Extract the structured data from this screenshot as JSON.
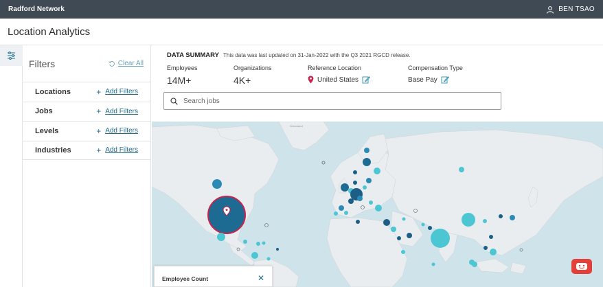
{
  "topbar": {
    "brand": "Radford Network",
    "user_name": "BEN TSAO"
  },
  "page": {
    "title": "Location Analytics"
  },
  "filters": {
    "title": "Filters",
    "clear_all": "Clear All",
    "items": [
      {
        "label": "Locations",
        "action": "Add Filters"
      },
      {
        "label": "Jobs",
        "action": "Add Filters"
      },
      {
        "label": "Levels",
        "action": "Add Filters"
      },
      {
        "label": "Industries",
        "action": "Add Filters"
      }
    ]
  },
  "summary": {
    "heading": "DATA SUMMARY",
    "note": "This data was last updated on 31-Jan-2022 with the Q3 2021 RGCD release.",
    "employees": {
      "label": "Employees",
      "value": "14M+"
    },
    "organizations": {
      "label": "Organizations",
      "value": "4K+"
    },
    "reference_location": {
      "label": "Reference Location",
      "value": "United States"
    },
    "compensation_type": {
      "label": "Compensation Type",
      "value": "Base Pay"
    }
  },
  "search": {
    "placeholder": "Search jobs"
  },
  "map": {
    "label": "Greenland"
  },
  "legend": {
    "title": "Employee Count"
  },
  "colors": {
    "topbar": "#3f4a54",
    "accent": "#1f6b8a",
    "marker_dark": "#1d5e86",
    "marker_light": "#4cc6d3",
    "selected_ring": "#c7254e",
    "chat": "#e4403a"
  },
  "icons": [
    "user-icon",
    "filter-sliders-icon",
    "reset-icon",
    "plus-icon",
    "location-pin-icon",
    "edit-icon",
    "search-icon",
    "close-icon",
    "chat-bot-icon"
  ]
}
